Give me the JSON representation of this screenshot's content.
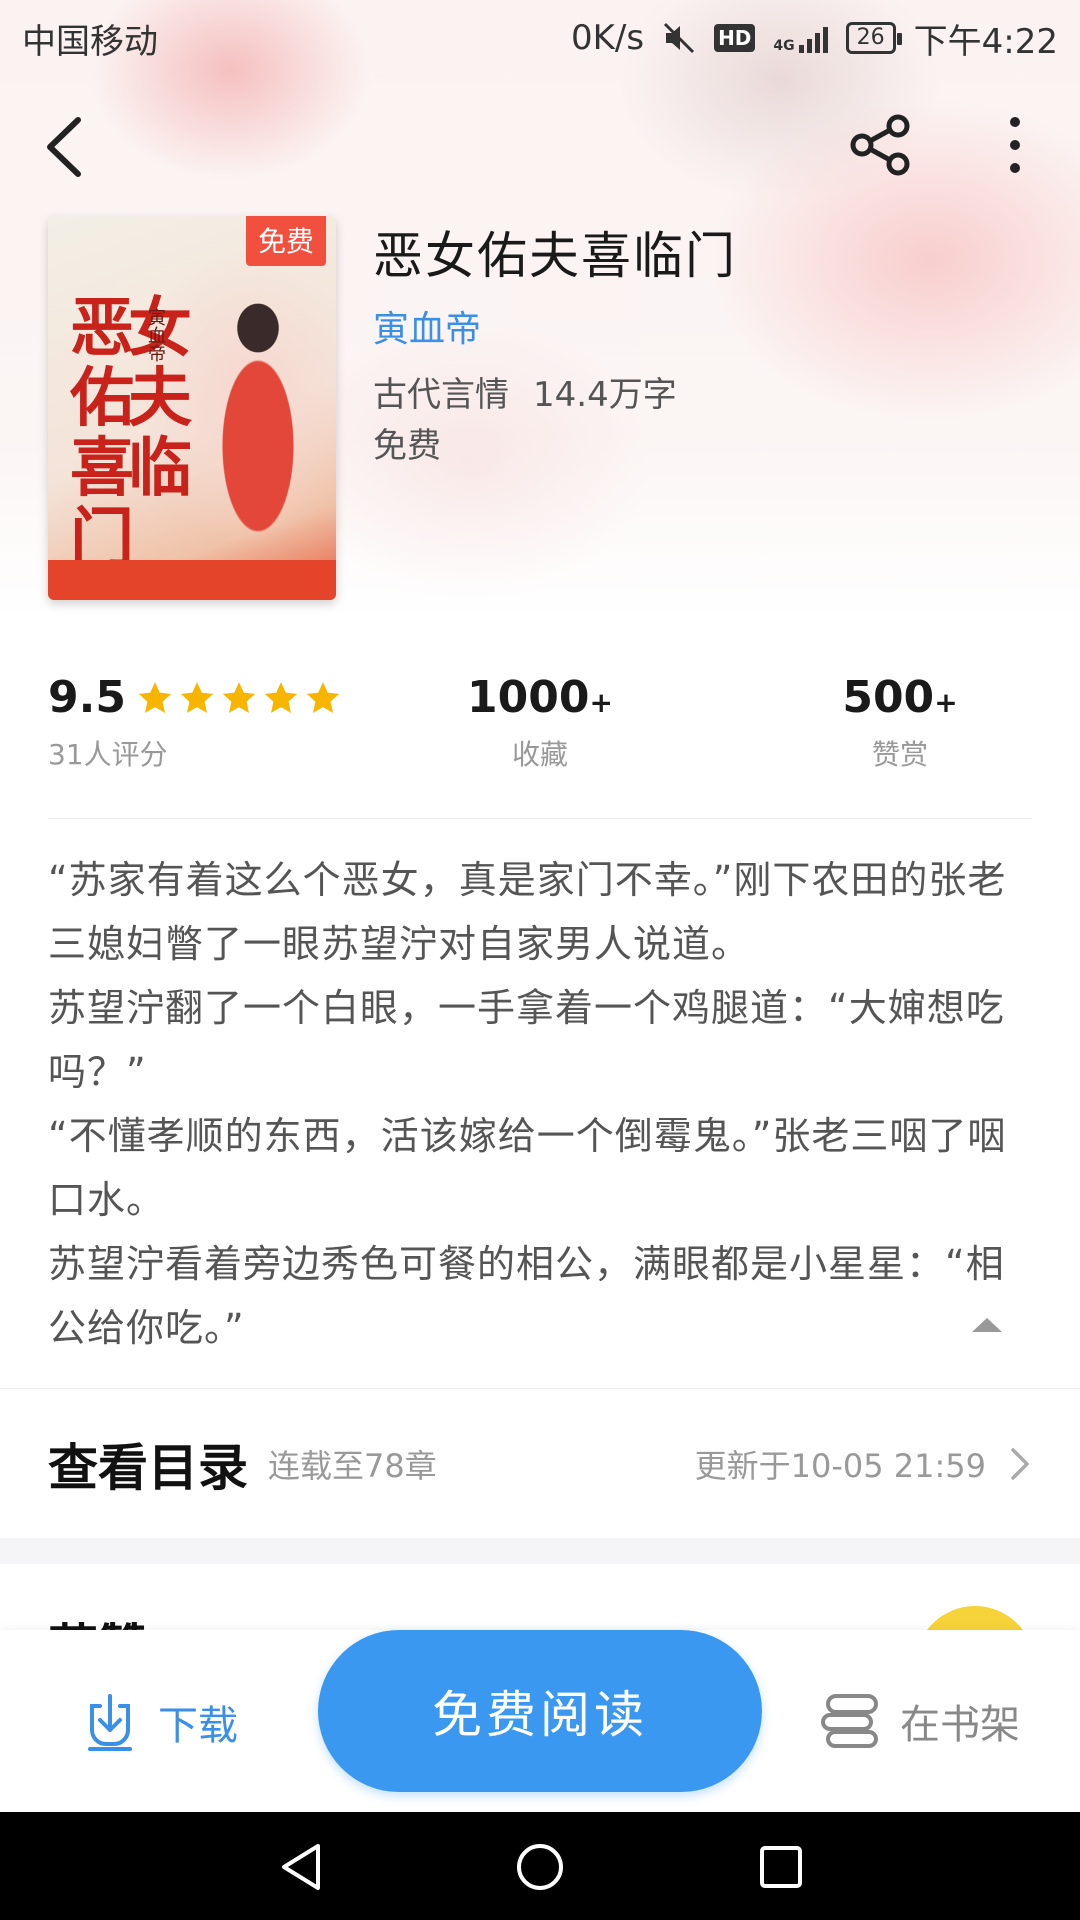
{
  "status_bar": {
    "carrier": "中国移动",
    "speed": "0K/s",
    "hd": "HD",
    "network": "4G",
    "battery": "26",
    "time": "下午4:22"
  },
  "book": {
    "cover_tag": "免费",
    "cover_title": "恶女佑夫喜临门",
    "cover_author": "寅血帝",
    "title": "恶女佑夫喜临门",
    "author": "寅血帝",
    "category": "古代言情",
    "word_count": "14.4万字",
    "price": "免费"
  },
  "stats": {
    "score": "9.5",
    "rating_stars": 5,
    "rating_count": "31人评分",
    "favorites": "1000",
    "favorites_suffix": "+",
    "favorites_label": "收藏",
    "rewards": "500",
    "rewards_suffix": "+",
    "rewards_label": "赞赏"
  },
  "intro": [
    "“苏家有着这么个恶女，真是家门不幸。”刚下农田的张老三媳妇瞥了一眼苏望泞对自家男人说道。",
    "苏望泞翻了一个白眼，一手拿着一个鸡腿道：“大婶想吃吗？”",
    "“不懂孝顺的东西，活该嫁给一个倒霉鬼。”张老三咽了咽口水。",
    "苏望泞看着旁边秀色可餐的相公，满眼都是小星星：“相公给你吃。”"
  ],
  "toc": {
    "title": "查看目录",
    "serial": "连载至78章",
    "updated": "更新于10-05 21:59"
  },
  "next_section_title": "获赞",
  "bottom_bar": {
    "download": "下载",
    "read": "免费阅读",
    "shelf": "在书架"
  },
  "colors": {
    "accent": "#3a98f0",
    "link": "#3a8fe6",
    "star": "#f7b500",
    "tag": "#f1503f"
  }
}
